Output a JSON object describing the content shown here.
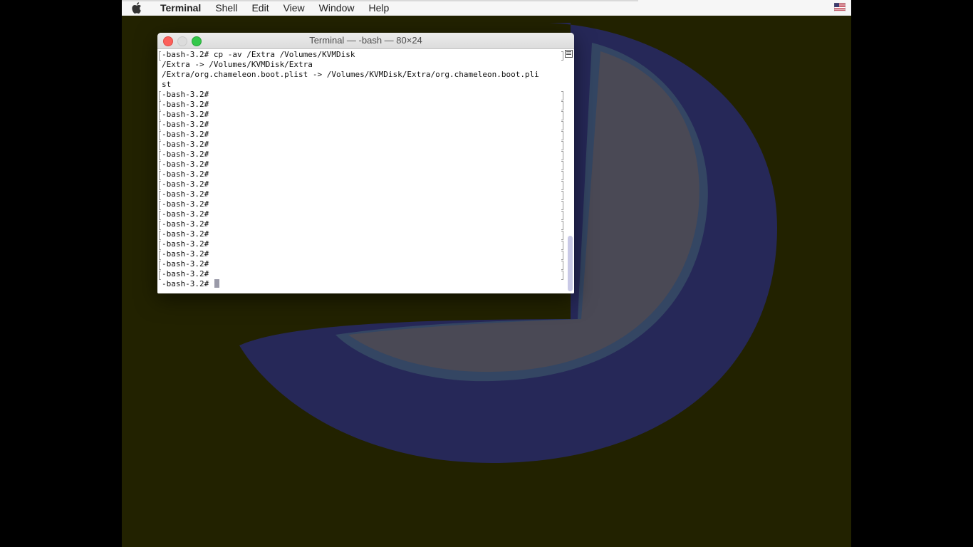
{
  "menubar": {
    "app_name": "Terminal",
    "items": [
      "Shell",
      "Edit",
      "View",
      "Window",
      "Help"
    ],
    "input_source_icon": "us-flag-icon"
  },
  "window": {
    "title": "Terminal — -bash — 80×24"
  },
  "terminal": {
    "lines": [
      "-bash-3.2# cp -av /Extra /Volumes/KVMDisk",
      "/Extra -> /Volumes/KVMDisk/Extra",
      "/Extra/org.chameleon.boot.plist -> /Volumes/KVMDisk/Extra/org.chameleon.boot.pli",
      "st",
      "-bash-3.2#",
      "-bash-3.2#",
      "-bash-3.2#",
      "-bash-3.2#",
      "-bash-3.2#",
      "-bash-3.2#",
      "-bash-3.2#",
      "-bash-3.2#",
      "-bash-3.2#",
      "-bash-3.2#",
      "-bash-3.2#",
      "-bash-3.2#",
      "-bash-3.2#",
      "-bash-3.2#",
      "-bash-3.2#",
      "-bash-3.2#",
      "-bash-3.2#",
      "-bash-3.2#",
      "-bash-3.2#"
    ],
    "prompt": "-bash-3.2# "
  },
  "colors": {
    "desktop_bg": "#222200",
    "wallpaper_outer": "#262858",
    "wallpaper_inner": "#4a4955"
  }
}
